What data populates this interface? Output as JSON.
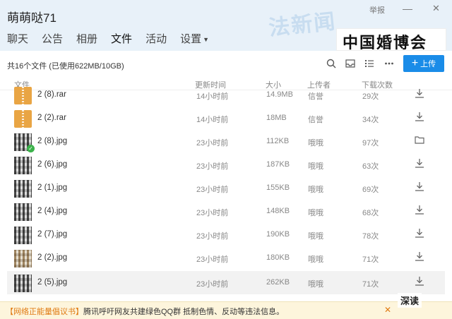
{
  "window": {
    "title": "萌萌哒71",
    "report_label": "举报",
    "min_label": "—",
    "close_label": "✕"
  },
  "tabs": [
    {
      "label": "聊天"
    },
    {
      "label": "公告"
    },
    {
      "label": "相册"
    },
    {
      "label": "文件",
      "active": true
    },
    {
      "label": "活动"
    },
    {
      "label": "设置",
      "dropdown": true
    }
  ],
  "overlays": {
    "news_watermark": "法新闻",
    "banner": "中国婚博会",
    "wechat_mark": "深读"
  },
  "toolbar": {
    "summary": "共16个文件 (已使用622MB/10GB)",
    "icons": [
      "search-icon",
      "inbox-icon",
      "list-view-icon",
      "more-icon"
    ],
    "upload_label": "上传",
    "upload_plus": "+"
  },
  "table": {
    "headers": {
      "name": "文件",
      "time": "更新时间",
      "size": "大小",
      "uploader": "上传者",
      "count": "下载次数"
    },
    "rows": [
      {
        "name": "2 (8).rar",
        "time": "14小时前",
        "size": "14.9MB",
        "uploader": "信誉",
        "count": "29次",
        "type": "rar",
        "action": "download"
      },
      {
        "name": "2 (2).rar",
        "time": "14小时前",
        "size": "18MB",
        "uploader": "信誉",
        "count": "34次",
        "type": "rar",
        "action": "download"
      },
      {
        "name": "2 (8).jpg",
        "time": "23小时前",
        "size": "112KB",
        "uploader": "哦哦",
        "count": "97次",
        "type": "jpg",
        "checked": true,
        "action": "folder"
      },
      {
        "name": "2 (6).jpg",
        "time": "23小时前",
        "size": "187KB",
        "uploader": "哦哦",
        "count": "63次",
        "type": "jpg",
        "action": "download"
      },
      {
        "name": "2 (1).jpg",
        "time": "23小时前",
        "size": "155KB",
        "uploader": "哦哦",
        "count": "69次",
        "type": "jpg",
        "action": "download"
      },
      {
        "name": "2 (4).jpg",
        "time": "23小时前",
        "size": "148KB",
        "uploader": "哦哦",
        "count": "68次",
        "type": "jpg",
        "action": "download"
      },
      {
        "name": "2 (7).jpg",
        "time": "23小时前",
        "size": "190KB",
        "uploader": "哦哦",
        "count": "78次",
        "type": "jpg",
        "action": "download"
      },
      {
        "name": "2 (2).jpg",
        "time": "23小时前",
        "size": "180KB",
        "uploader": "哦哦",
        "count": "71次",
        "type": "jpg",
        "warm": true,
        "action": "download"
      },
      {
        "name": "2 (5).jpg",
        "time": "23小时前",
        "size": "262KB",
        "uploader": "哦哦",
        "count": "71次",
        "type": "jpg",
        "highlight": true,
        "action": "download"
      }
    ]
  },
  "notice": {
    "link_text": "【网络正能量倡议书】",
    "text": "腾讯呼吁网友共建绿色QQ群 抵制色情、反动等违法信息。",
    "close_label": "✕"
  },
  "colors": {
    "accent": "#1a8ce8",
    "header_bg": "#e8f1f9",
    "notice_bg": "#fdf5dc",
    "rar_icon": "#e9a544",
    "check_badge": "#3bb24a"
  }
}
